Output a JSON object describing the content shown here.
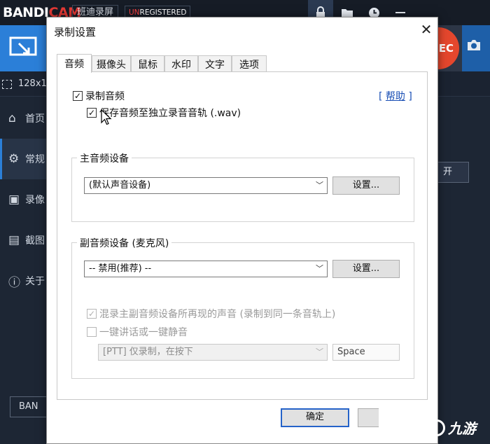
{
  "app": {
    "logo_main": "BANDI",
    "logo_accent": "CAM",
    "subtitle": "班迪录屏",
    "unregistered_prefix": "UN",
    "unregistered_rest": "REGISTERED",
    "size_text": "128x1",
    "rec_label": "EC",
    "sidebar": [
      {
        "label": "首页",
        "icon": "home-icon",
        "glyph": "⌂"
      },
      {
        "label": "常规",
        "icon": "gear-icon",
        "glyph": "⚙"
      },
      {
        "label": "录像",
        "icon": "video-settings-icon",
        "glyph": "▣"
      },
      {
        "label": "截图",
        "icon": "image-settings-icon",
        "glyph": "▤"
      },
      {
        "label": "关于",
        "icon": "info-icon",
        "glyph": "ⓘ"
      }
    ],
    "bottom_button": "BAN",
    "right_button": "开"
  },
  "dialog": {
    "title": "录制设置",
    "close_glyph": "✕",
    "tabs": [
      "音频",
      "摄像头",
      "鼠标",
      "水印",
      "文字",
      "选项"
    ],
    "record_audio": {
      "label": "录制音频",
      "checked": true
    },
    "help_text": "帮助",
    "help_open": "[ ",
    "help_close": " ]",
    "save_separate": {
      "label": "保存音频至独立录音音轨 (.wav)",
      "checked": true
    },
    "main_device": {
      "title": "主音频设备",
      "selected": "(默认声音设备)",
      "settings_button": "设置..."
    },
    "secondary_device": {
      "title": "副音频设备 (麦克风)",
      "selected": "-- 禁用(推荐) --",
      "settings_button": "设置..."
    },
    "mix_option": {
      "label": "混录主副音频设备所再现的声音 (录制到同一条音轨上)",
      "checked": true
    },
    "ptt_option": {
      "label": "一键讲话或一键静音",
      "checked": false
    },
    "ptt_mode": "[PTT] 仅录制，在按下",
    "ptt_key": "Space",
    "ok_button": "确定"
  },
  "watermark": {
    "text": "九游"
  }
}
